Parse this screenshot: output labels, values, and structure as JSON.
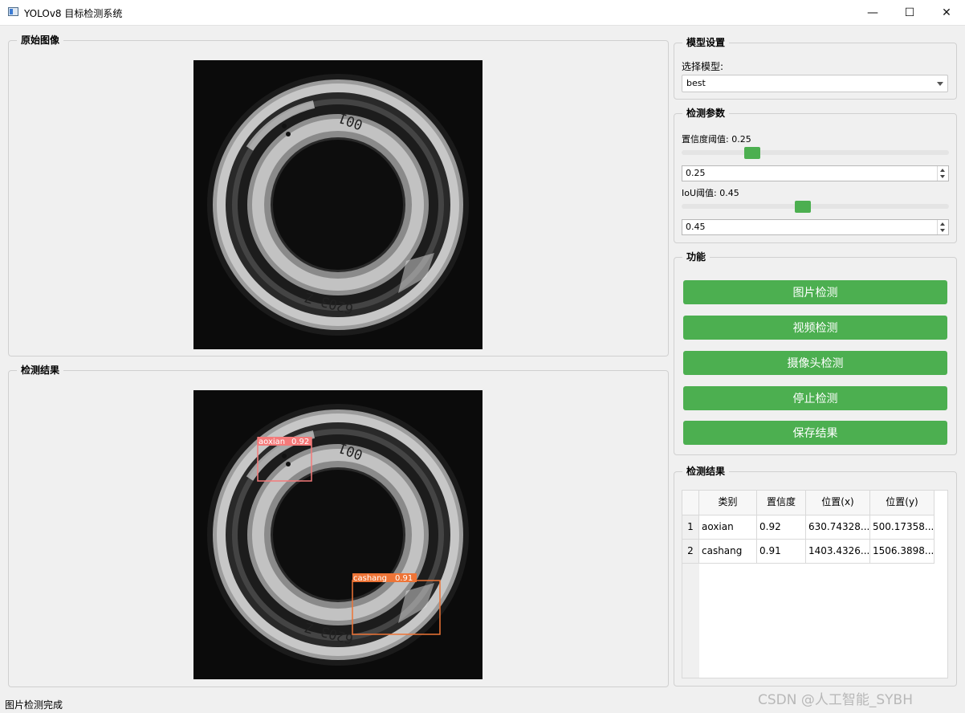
{
  "window": {
    "title": "YOLOv8 目标检测系统",
    "minimize_glyph": "—",
    "maximize_glyph": "☐",
    "close_glyph": "✕"
  },
  "original_panel": {
    "title": "原始图像"
  },
  "result_panel": {
    "title": "检测结果",
    "detections": [
      {
        "label": "aoxian",
        "confidence": "0.92",
        "color": "#f47a7a"
      },
      {
        "label": "cashang",
        "confidence": "0.91",
        "color": "#ee7436"
      }
    ]
  },
  "image_text": {
    "top": "001",
    "bottom": "6203 Z"
  },
  "model_settings": {
    "title": "模型设置",
    "select_label": "选择模型:",
    "selected_model": "best"
  },
  "detect_params": {
    "title": "检测参数",
    "confidence_label": "置信度阈值: 0.25",
    "confidence_value": "0.25",
    "confidence_fraction": 0.25,
    "iou_label": "IoU阈值: 0.45",
    "iou_value": "0.45",
    "iou_fraction": 0.45
  },
  "functions": {
    "title": "功能",
    "image_detect": "图片检测",
    "video_detect": "视频检测",
    "camera_detect": "摄像头检测",
    "stop_detect": "停止检测",
    "save_results": "保存结果"
  },
  "results_table": {
    "title": "检测结果",
    "headers": [
      "类别",
      "置信度",
      "位置(x)",
      "位置(y)"
    ],
    "rows": [
      {
        "index": "1",
        "cells": [
          "aoxian",
          "0.92",
          "630.74328...",
          "500.17358..."
        ]
      },
      {
        "index": "2",
        "cells": [
          "cashang",
          "0.91",
          "1403.4326...",
          "1506.3898..."
        ]
      }
    ]
  },
  "status_bar": "图片检测完成",
  "watermark": "CSDN @人工智能_SYBH",
  "colors": {
    "accent_green": "#4caf50"
  }
}
